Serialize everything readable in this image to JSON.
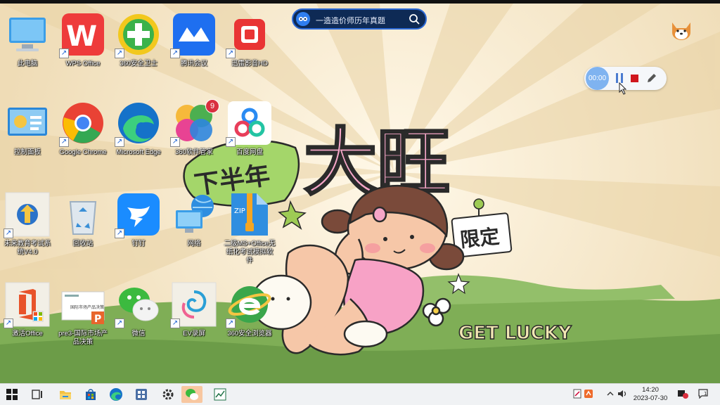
{
  "desktop": {
    "icons": [
      {
        "label": "此电脑",
        "shortcut": false
      },
      {
        "label": "WPS Office",
        "shortcut": true
      },
      {
        "label": "360安全卫士",
        "shortcut": true
      },
      {
        "label": "腾讯会议",
        "shortcut": true
      },
      {
        "label": "迅雷影音HD",
        "shortcut": true
      },
      {
        "label": "控制面板",
        "shortcut": false
      },
      {
        "label": "Google Chrome",
        "shortcut": true
      },
      {
        "label": "Microsoft Edge",
        "shortcut": true
      },
      {
        "label": "360软件管家",
        "shortcut": true,
        "badge": "9"
      },
      {
        "label": "百度网盘",
        "shortcut": true
      },
      {
        "label": "未来教育考试系统V4.0",
        "shortcut": true
      },
      {
        "label": "回收站",
        "shortcut": false
      },
      {
        "label": "钉钉",
        "shortcut": true
      },
      {
        "label": "网络",
        "shortcut": false
      },
      {
        "label": "二级MS+Office无纸化考试模拟软件",
        "shortcut": false
      },
      {
        "label": "激活Office",
        "shortcut": true
      },
      {
        "label": "pre3-国际市场产品决策",
        "shortcut": false
      },
      {
        "label": "微信",
        "shortcut": true
      },
      {
        "label": "EV录屏",
        "shortcut": true
      },
      {
        "label": "360安全浏览器",
        "shortcut": true
      }
    ]
  },
  "wallpaper": {
    "banner": "下半年",
    "title": "大旺",
    "tag": "限定",
    "slogan": "GET LUCKY",
    "doc_title": "国际市场产品决策"
  },
  "search": {
    "placeholder": "一造造价师历年真题"
  },
  "recorder": {
    "time": "00:00"
  },
  "taskbar": {
    "items": [
      "start",
      "task-view",
      "file-explorer",
      "microsoft-store",
      "edge",
      "control-panel",
      "settings",
      "wechat",
      "excel"
    ],
    "clock_time": "14:20",
    "clock_date": "2023-07-30",
    "notification_count": "1"
  }
}
